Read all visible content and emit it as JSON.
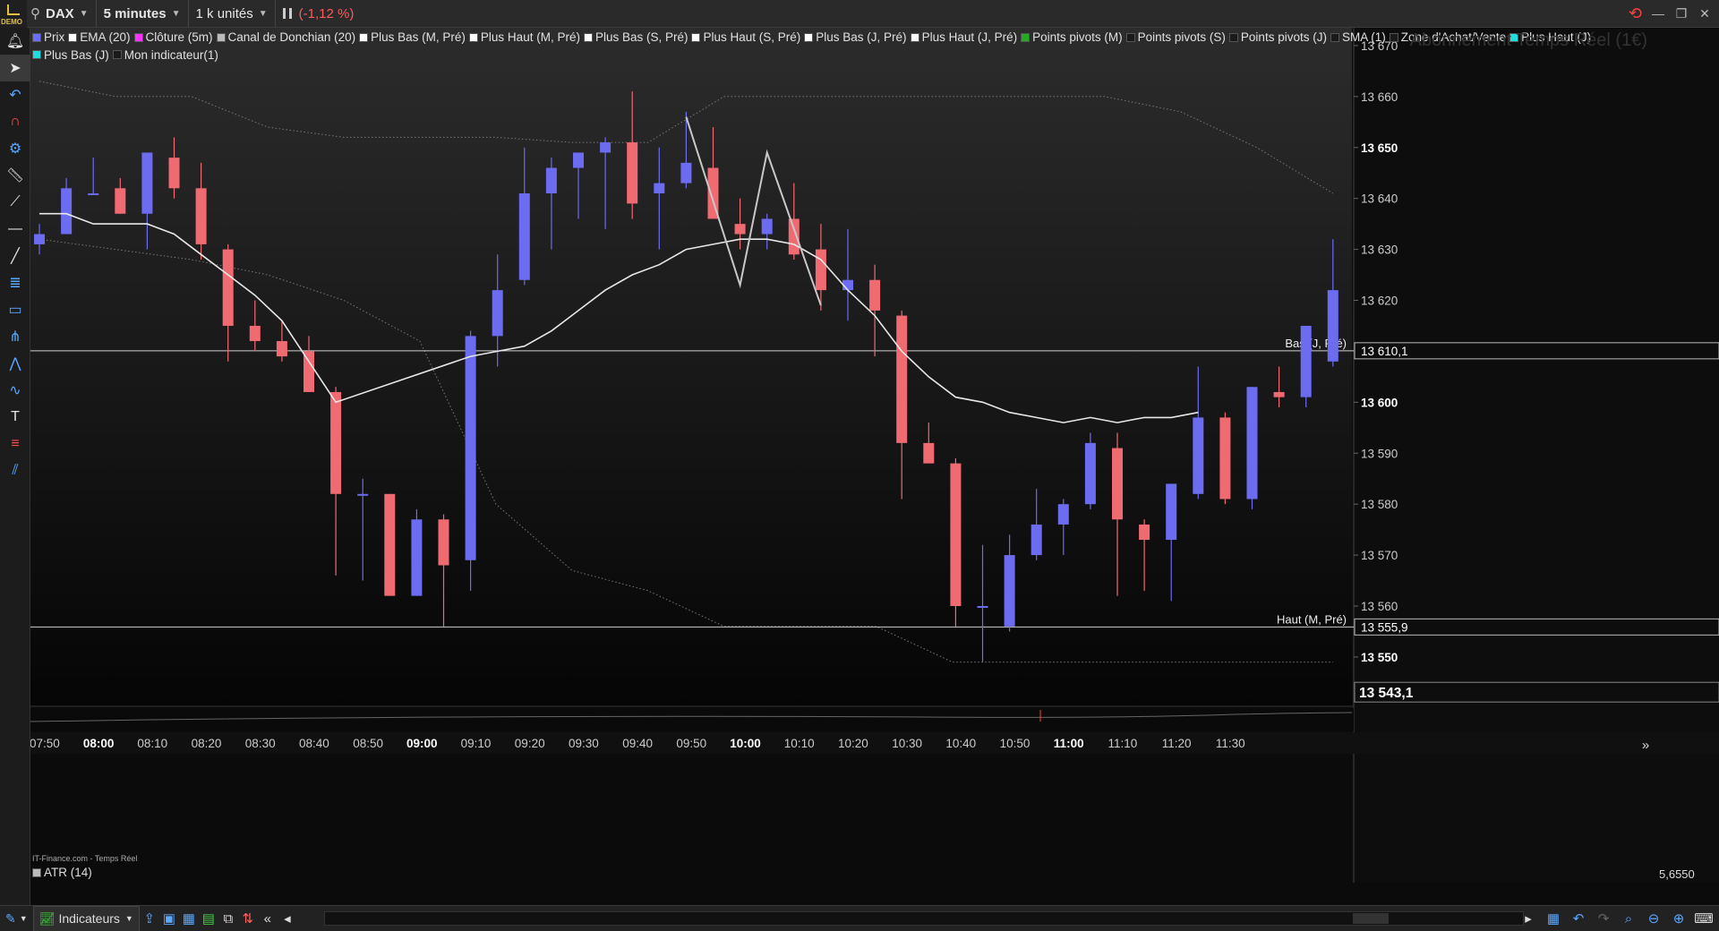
{
  "topbar": {
    "demo_label": "DEMO",
    "instrument": "DAX",
    "timeframe": "5 minutes",
    "units": "1 k unités",
    "change": "(-1,12 %)"
  },
  "legend": [
    {
      "label": "Prix",
      "color": "#6c6cff"
    },
    {
      "label": "EMA (20)",
      "color": "#ffffff"
    },
    {
      "label": "Clôture (5m)",
      "color": "#ff33ff"
    },
    {
      "label": "Canal de Donchian (20)",
      "color": "#bbbbbb"
    },
    {
      "label": "Plus Bas (M, Pré)",
      "color": "#ffffff"
    },
    {
      "label": "Plus Haut (M, Pré)",
      "color": "#ffffff"
    },
    {
      "label": "Plus Bas (S, Pré)",
      "color": "#ffffff"
    },
    {
      "label": "Plus Haut (S, Pré)",
      "color": "#ffffff"
    },
    {
      "label": "Plus Bas (J, Pré)",
      "color": "#ffffff"
    },
    {
      "label": "Plus Haut (J, Pré)",
      "color": "#ffffff"
    },
    {
      "label": "Points pivots (M)",
      "color": "#22aa22"
    },
    {
      "label": "Points pivots (S)",
      "color": "#1a1a1a"
    },
    {
      "label": "Points pivots (J)",
      "color": "#1a1a1a"
    },
    {
      "label": "SMA (1)",
      "color": "#1a1a1a"
    },
    {
      "label": "Zone d'Achat/Vente",
      "color": "#1a1a1a"
    },
    {
      "label": "Plus Haut (J)",
      "color": "#22dddd"
    },
    {
      "label": "Plus Bas (J)",
      "color": "#22dddd"
    },
    {
      "label": "Mon indicateur(1)",
      "color": "#1a1a1a"
    }
  ],
  "watermark": "Abonnement Temps Réel (1€)",
  "source": "IT-Finance.com - Temps Réel",
  "atr": {
    "label": "ATR (14)",
    "value": "5,6550"
  },
  "bottombar": {
    "indicators_label": "Indicateurs"
  },
  "colors": {
    "up": "#6c6cf0",
    "down": "#f06a72",
    "ema": "#e8e8e8",
    "level": "#cfcfcf"
  },
  "chart_data": {
    "type": "candlestick",
    "instrument": "DAX",
    "interval": "5 minutes",
    "ylim": [
      13540.5,
      13673.5
    ],
    "y_ticks": [
      13550,
      13560,
      13570,
      13580,
      13590,
      13600,
      13610,
      13620,
      13630,
      13640,
      13650,
      13660,
      13670
    ],
    "y_tick_labels": [
      "13 550",
      "13 560",
      "13 570",
      "13 580",
      "13 590",
      "13 600",
      "13 610",
      "13 620",
      "13 630",
      "13 640",
      "13 650",
      "13 660",
      "13 670"
    ],
    "y_ticks_bold": [
      13550,
      13600,
      13650
    ],
    "x_ticks": [
      "07:50",
      "08:00",
      "08:10",
      "08:20",
      "08:30",
      "08:40",
      "08:50",
      "09:00",
      "09:10",
      "09:20",
      "09:30",
      "09:40",
      "09:50",
      "10:00",
      "10:10",
      "10:20",
      "10:30",
      "10:40",
      "10:50",
      "11:00",
      "11:10",
      "11:20",
      "11:30"
    ],
    "x_ticks_bold": [
      "08:00",
      "09:00",
      "10:00",
      "11:00"
    ],
    "candles": [
      {
        "o": 13631,
        "h": 13635,
        "l": 13629,
        "c": 13633
      },
      {
        "o": 13633,
        "h": 13644,
        "l": 13633,
        "c": 13642
      },
      {
        "o": 13641,
        "h": 13648,
        "l": 13641,
        "c": 13641
      },
      {
        "o": 13642,
        "h": 13644,
        "l": 13637,
        "c": 13637
      },
      {
        "o": 13637,
        "h": 13649,
        "l": 13630,
        "c": 13649
      },
      {
        "o": 13648,
        "h": 13652,
        "l": 13640,
        "c": 13642
      },
      {
        "o": 13642,
        "h": 13647,
        "l": 13628,
        "c": 13631
      },
      {
        "o": 13630,
        "h": 13631,
        "l": 13608,
        "c": 13615
      },
      {
        "o": 13615,
        "h": 13620,
        "l": 13610,
        "c": 13612
      },
      {
        "o": 13612,
        "h": 13616,
        "l": 13608,
        "c": 13609
      },
      {
        "o": 13610,
        "h": 13613,
        "l": 13602,
        "c": 13602
      },
      {
        "o": 13602,
        "h": 13603,
        "l": 13566,
        "c": 13582
      },
      {
        "o": 13582,
        "h": 13585,
        "l": 13565,
        "c": 13582
      },
      {
        "o": 13582,
        "h": 13582,
        "l": 13562,
        "c": 13562
      },
      {
        "o": 13562,
        "h": 13579,
        "l": 13562,
        "c": 13577
      },
      {
        "o": 13577,
        "h": 13578,
        "l": 13556,
        "c": 13568
      },
      {
        "o": 13569,
        "h": 13614,
        "l": 13563,
        "c": 13613
      },
      {
        "o": 13613,
        "h": 13629,
        "l": 13607,
        "c": 13622
      },
      {
        "o": 13624,
        "h": 13650,
        "l": 13623,
        "c": 13641
      },
      {
        "o": 13641,
        "h": 13648,
        "l": 13630,
        "c": 13646
      },
      {
        "o": 13646,
        "h": 13649,
        "l": 13636,
        "c": 13649
      },
      {
        "o": 13649,
        "h": 13652,
        "l": 13634,
        "c": 13651
      },
      {
        "o": 13651,
        "h": 13661,
        "l": 13636,
        "c": 13639
      },
      {
        "o": 13641,
        "h": 13650,
        "l": 13630,
        "c": 13643
      },
      {
        "o": 13643,
        "h": 13657,
        "l": 13642,
        "c": 13647
      },
      {
        "o": 13646,
        "h": 13654,
        "l": 13636,
        "c": 13636
      },
      {
        "o": 13635,
        "h": 13640,
        "l": 13630,
        "c": 13633
      },
      {
        "o": 13633,
        "h": 13637,
        "l": 13630,
        "c": 13636
      },
      {
        "o": 13636,
        "h": 13643,
        "l": 13628,
        "c": 13629
      },
      {
        "o": 13630,
        "h": 13635,
        "l": 13618,
        "c": 13622
      },
      {
        "o": 13622,
        "h": 13634,
        "l": 13616,
        "c": 13624
      },
      {
        "o": 13624,
        "h": 13627,
        "l": 13609,
        "c": 13618
      },
      {
        "o": 13617,
        "h": 13618,
        "l": 13581,
        "c": 13592
      },
      {
        "o": 13592,
        "h": 13596,
        "l": 13588,
        "c": 13588
      },
      {
        "o": 13588,
        "h": 13589,
        "l": 13556,
        "c": 13560
      },
      {
        "o": 13560,
        "h": 13572,
        "l": 13549,
        "c": 13560
      },
      {
        "o": 13556,
        "h": 13574,
        "l": 13555,
        "c": 13570
      },
      {
        "o": 13570,
        "h": 13583,
        "l": 13569,
        "c": 13576
      },
      {
        "o": 13576,
        "h": 13581,
        "l": 13570,
        "c": 13580
      },
      {
        "o": 13580,
        "h": 13594,
        "l": 13579,
        "c": 13592
      },
      {
        "o": 13591,
        "h": 13594,
        "l": 13562,
        "c": 13577
      },
      {
        "o": 13576,
        "h": 13577,
        "l": 13563,
        "c": 13573
      },
      {
        "o": 13573,
        "h": 13584,
        "l": 13561,
        "c": 13584
      },
      {
        "o": 13582,
        "h": 13607,
        "l": 13581,
        "c": 13597
      },
      {
        "o": 13597,
        "h": 13598,
        "l": 13580,
        "c": 13581
      },
      {
        "o": 13581,
        "h": 13603,
        "l": 13579,
        "c": 13603
      },
      {
        "o": 13602,
        "h": 13607,
        "l": 13599,
        "c": 13601
      },
      {
        "o": 13601,
        "h": 13613,
        "l": 13599,
        "c": 13615
      },
      {
        "o": 13608,
        "h": 13632,
        "l": 13607,
        "c": 13622
      }
    ],
    "ema": [
      13637,
      13637,
      13635,
      13635,
      13635,
      13633,
      13629,
      13625,
      13621,
      13616,
      13608,
      13600,
      13609,
      13610,
      13611,
      13614,
      13618,
      13622,
      13625,
      13627,
      13630,
      13631,
      13632,
      13632,
      13631,
      13628,
      13622,
      13617,
      13610,
      13605,
      13601,
      13600,
      13598,
      13597,
      13596,
      13597,
      13596,
      13597,
      13597,
      13598
    ],
    "ema_candle_index": [
      0,
      1,
      2,
      3,
      4,
      5,
      6,
      7,
      8,
      9,
      10,
      11,
      16,
      17,
      18,
      19,
      20,
      21,
      22,
      23,
      24,
      25,
      26,
      27,
      28,
      29,
      30,
      31,
      32,
      33,
      34,
      35,
      36,
      37,
      38,
      39,
      40,
      41,
      42,
      43
    ],
    "zigzag": [
      {
        "i": 24,
        "v": 13656
      },
      {
        "i": 26,
        "v": 13623
      },
      {
        "i": 27,
        "v": 13649
      },
      {
        "i": 29,
        "v": 13619
      }
    ],
    "level_lines": [
      {
        "label": "Bas (J, Pré)",
        "value": 13610.1,
        "value_label": "13 610,1"
      },
      {
        "label": "Haut (M, Pré)",
        "value": 13555.9,
        "value_label": "13 555,9"
      }
    ],
    "last_price": {
      "value": 13543.1,
      "label": "13 543,1"
    },
    "donchian_high": [
      13663,
      13660,
      13660,
      13654,
      13652,
      13652,
      13652,
      13651,
      13651,
      13660,
      13660,
      13660,
      13660,
      13660,
      13660,
      13657,
      13650,
      13641
    ],
    "donchian_low": [
      13632,
      13630,
      13628,
      13625,
      13620,
      13612,
      13580,
      13567,
      13563,
      13556,
      13556,
      13556,
      13549,
      13549,
      13549,
      13549,
      13549,
      13549
    ]
  }
}
